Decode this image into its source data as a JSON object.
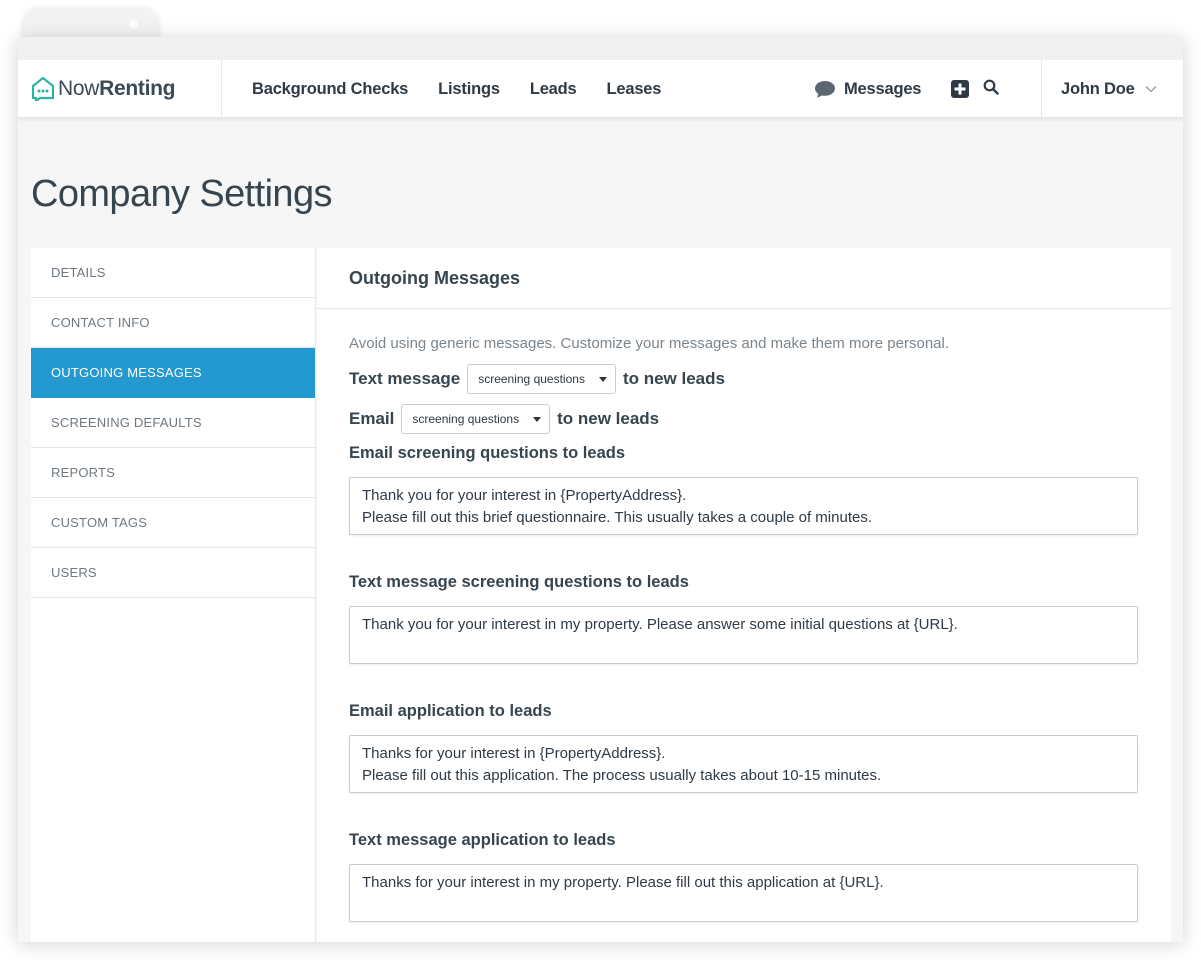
{
  "brand": {
    "name_part1": "Now",
    "name_part2": "Renting",
    "accent_color": "#2db3a0"
  },
  "nav": {
    "links": [
      "Background Checks",
      "Listings",
      "Leads",
      "Leases"
    ],
    "messages_label": "Messages",
    "user_name": "John Doe"
  },
  "page": {
    "title": "Company Settings"
  },
  "sidebar": {
    "active_color": "#2499cf",
    "items": [
      {
        "label": "DETAILS",
        "active": false
      },
      {
        "label": "CONTACT INFO",
        "active": false
      },
      {
        "label": "OUTGOING MESSAGES",
        "active": true
      },
      {
        "label": "SCREENING DEFAULTS",
        "active": false
      },
      {
        "label": "REPORTS",
        "active": false
      },
      {
        "label": "CUSTOM TAGS",
        "active": false
      },
      {
        "label": "USERS",
        "active": false
      }
    ]
  },
  "outgoing": {
    "title": "Outgoing Messages",
    "hint": "Avoid using generic messages. Customize your messages and make them more personal.",
    "text_row": {
      "label": "Text message",
      "selected": "screening questions",
      "suffix": "to new leads"
    },
    "email_row": {
      "label": "Email",
      "selected": "screening questions",
      "suffix": "to new leads"
    },
    "fields": [
      {
        "label": "Email screening questions to leads",
        "value": "Thank you for your interest in {PropertyAddress}.\nPlease fill out this brief questionnaire. This usually takes a couple of minutes."
      },
      {
        "label": "Text message screening questions to leads",
        "value": "Thank you for your interest in my property. Please answer some initial questions at {URL}."
      },
      {
        "label": "Email application to leads",
        "value": "Thanks for your interest in {PropertyAddress}.\nPlease fill out this application. The process usually takes about 10-15 minutes."
      },
      {
        "label": "Text message application to leads",
        "value": "Thanks for your interest in my property. Please fill out this application at {URL}."
      }
    ]
  }
}
